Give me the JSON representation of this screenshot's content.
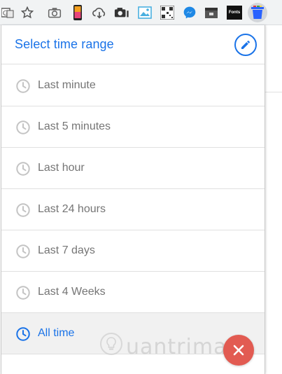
{
  "popup": {
    "title": "Select time range",
    "edit_icon": "pencil-icon"
  },
  "ranges": [
    {
      "label": "Last minute",
      "icon": "clock-icon",
      "selected": false
    },
    {
      "label": "Last 5 minutes",
      "icon": "clock-icon",
      "selected": false
    },
    {
      "label": "Last hour",
      "icon": "clock-icon",
      "selected": false
    },
    {
      "label": "Last 24 hours",
      "icon": "clock-icon",
      "selected": false
    },
    {
      "label": "Last 7 days",
      "icon": "clock-icon",
      "selected": false
    },
    {
      "label": "Last 4 Weeks",
      "icon": "clock-icon",
      "selected": false
    },
    {
      "label": "All time",
      "icon": "clock-icon",
      "selected": true
    }
  ],
  "toolbar": {
    "fonts_label": "Fonts",
    "icons": [
      "translate-icon",
      "star-icon",
      "camera-icon",
      "phone-icon",
      "cloud-download-icon",
      "camera-filled-icon",
      "image-icon",
      "qr-code-icon",
      "messenger-icon",
      "archive-icon",
      "fonts-extension-icon",
      "trash-extension-icon"
    ]
  },
  "watermark": {
    "text": "uantrimang"
  },
  "colors": {
    "accent": "#1a73e8",
    "muted_text": "#757575",
    "close": "#e25b52"
  }
}
